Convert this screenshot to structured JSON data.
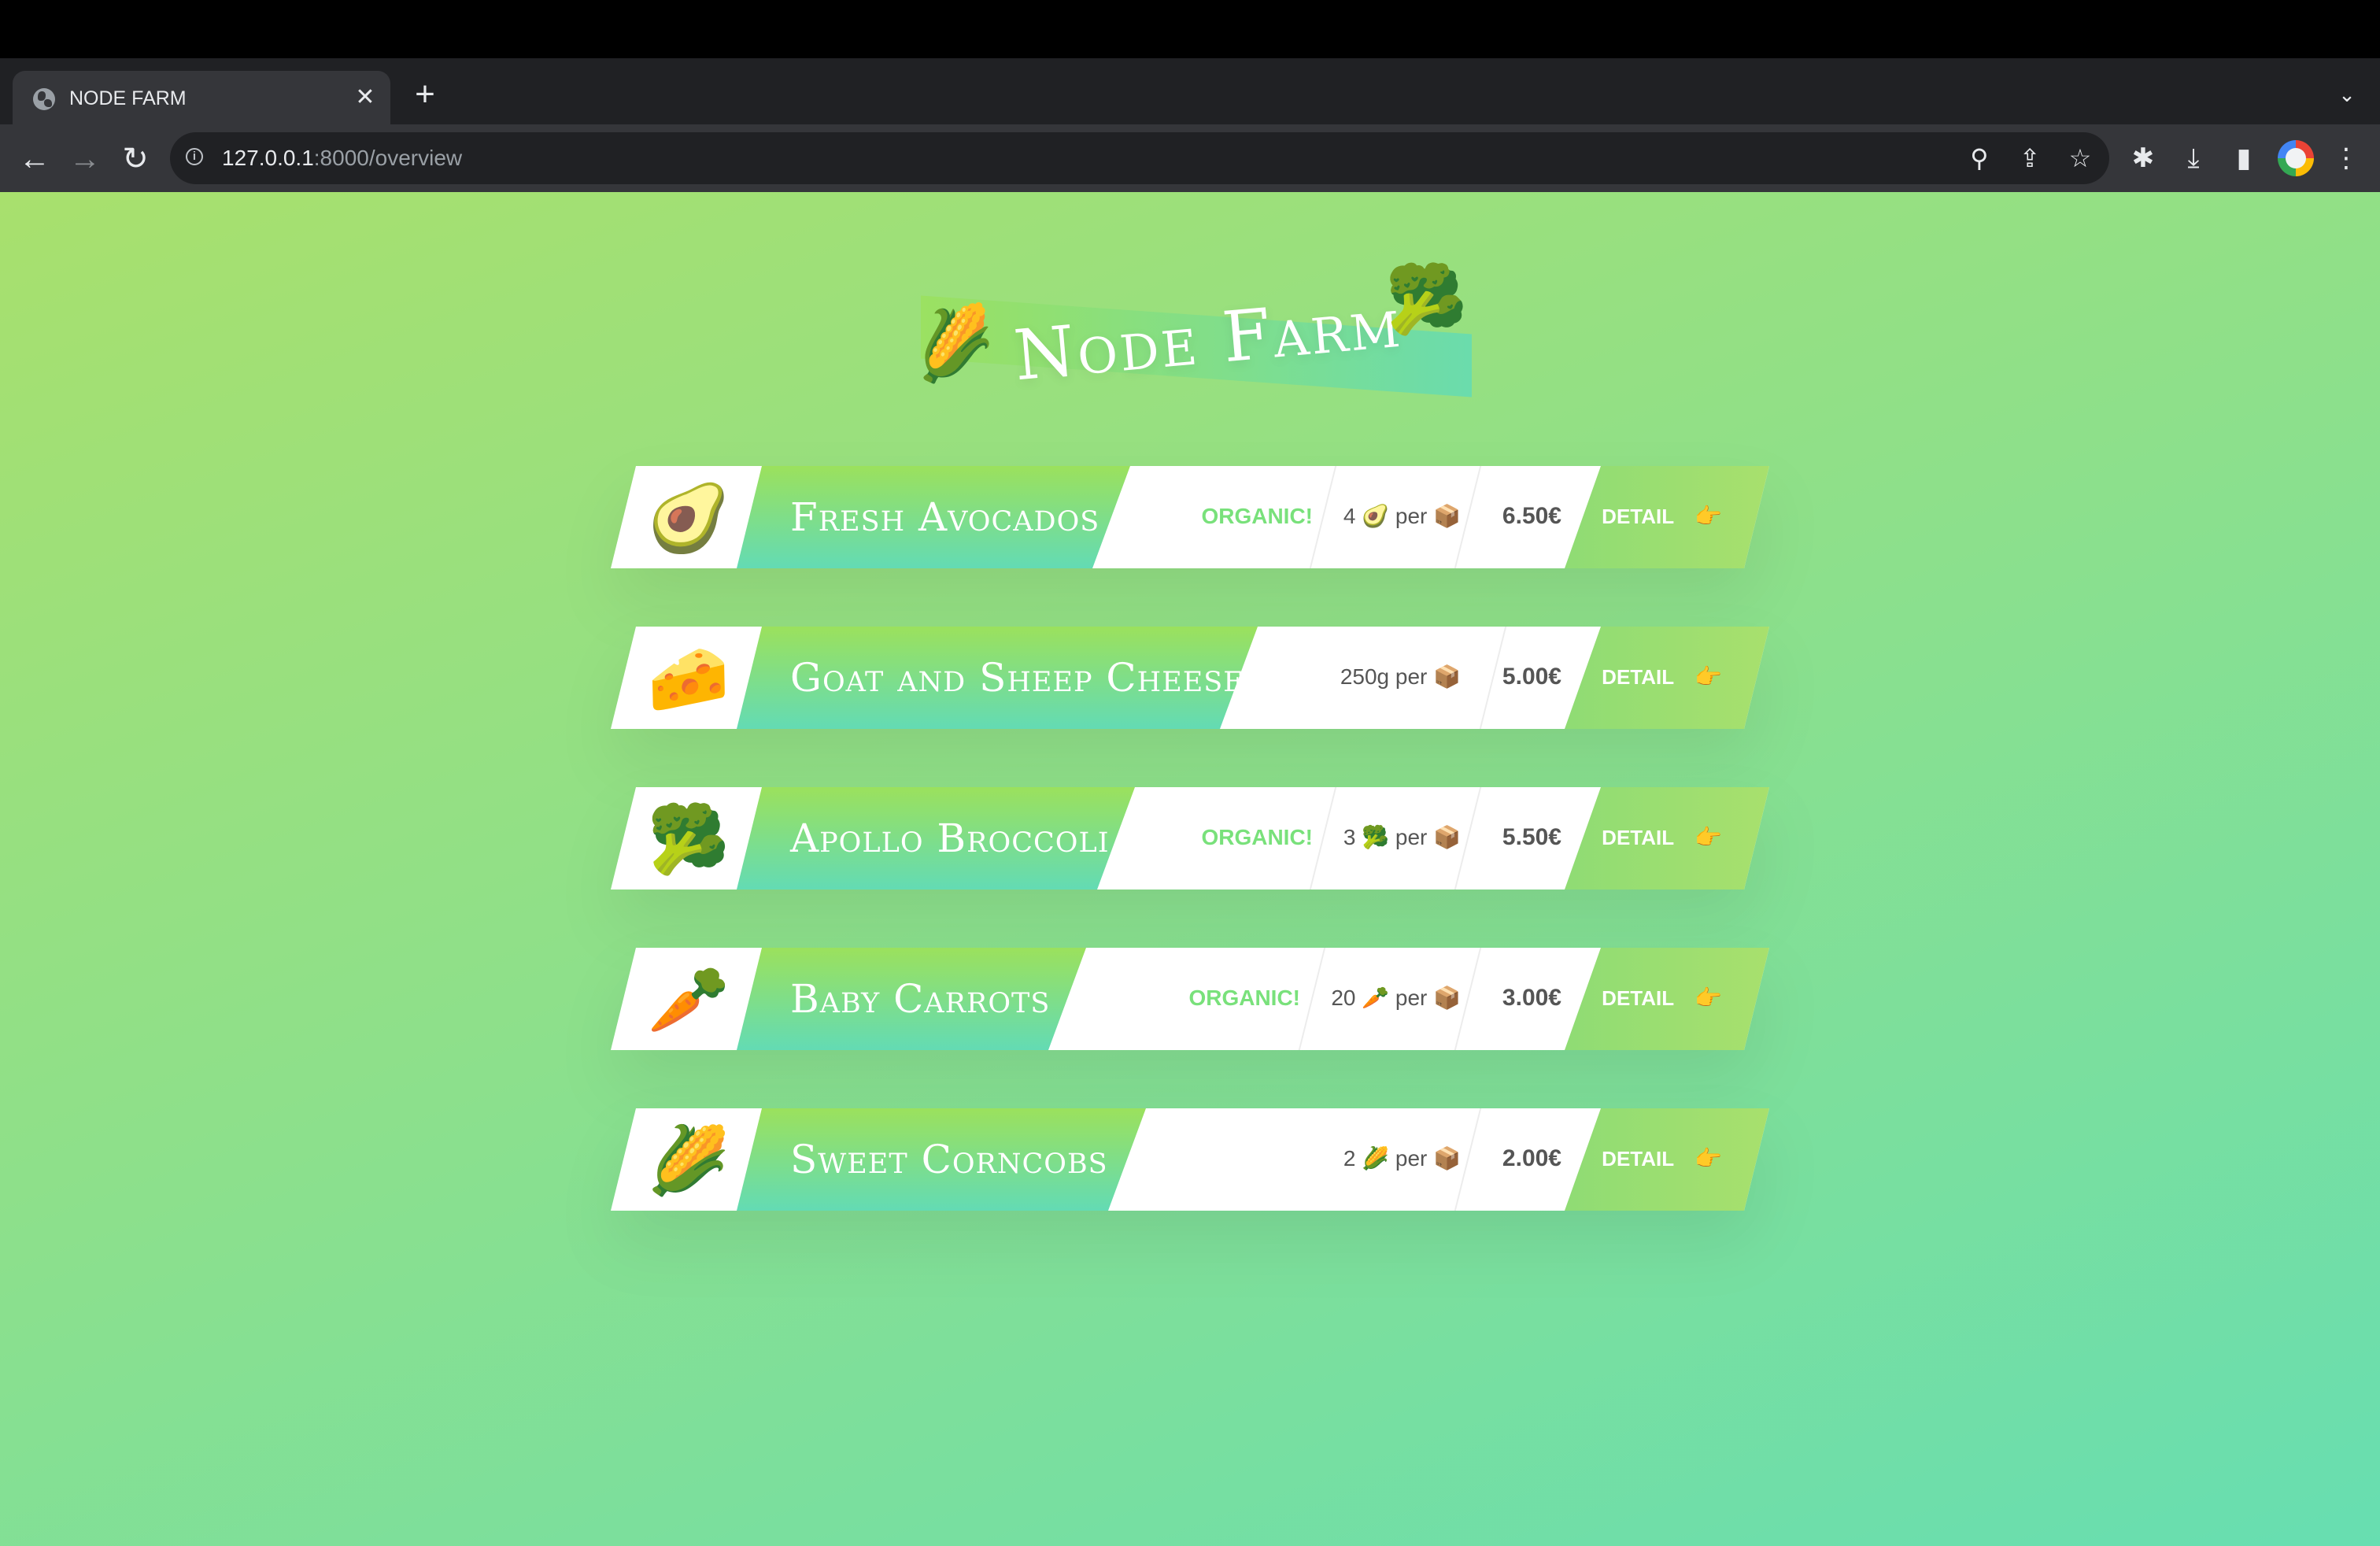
{
  "browser": {
    "tab": {
      "title": "NODE FARM",
      "favicon": "globe-icon",
      "close_label": "✕"
    },
    "new_tab_label": "+",
    "tab_menu_label": "⌄",
    "url_host": "127.0.0.1",
    "url_path": ":8000/overview",
    "icons": {
      "back": "←",
      "forward": "→",
      "reload": "↻",
      "info": "i",
      "zoom": "⚲",
      "share": "⇪",
      "bookmark": "☆",
      "extensions": "✱",
      "download": "⤓",
      "side_panel": "▮",
      "menu": "⋮"
    }
  },
  "page": {
    "logo": {
      "title": "Node Farm",
      "left_emoji": "🌽",
      "right_emoji": "🥦"
    },
    "products": [
      {
        "emoji": "🥑",
        "name": "Fresh Avocados",
        "organic": "Organic!",
        "quantity": "4 🥑 per 📦",
        "price": "6.50€",
        "detail": "Detail",
        "detail_icon": "👉"
      },
      {
        "emoji": "🧀",
        "name": "Goat and Sheep Cheese",
        "organic": "",
        "quantity": "250g per 📦",
        "price": "5.00€",
        "detail": "Detail",
        "detail_icon": "👉"
      },
      {
        "emoji": "🥦",
        "name": "Apollo Broccoli",
        "organic": "Organic!",
        "quantity": "3 🥦 per 📦",
        "price": "5.50€",
        "detail": "Detail",
        "detail_icon": "👉"
      },
      {
        "emoji": "🥕",
        "name": "Baby Carrots",
        "organic": "Organic!",
        "quantity": "20 🥕 per 📦",
        "price": "3.00€",
        "detail": "Detail",
        "detail_icon": "👉"
      },
      {
        "emoji": "🌽",
        "name": "Sweet Corncobs",
        "organic": "",
        "quantity": "2 🌽 per 📦",
        "price": "2.00€",
        "detail": "Detail",
        "detail_icon": "👉"
      }
    ]
  },
  "colors": {
    "gradient_start": "#9be15d",
    "gradient_end": "#63dbb4",
    "organic_green": "#79e17b",
    "text_gray": "#555555"
  }
}
